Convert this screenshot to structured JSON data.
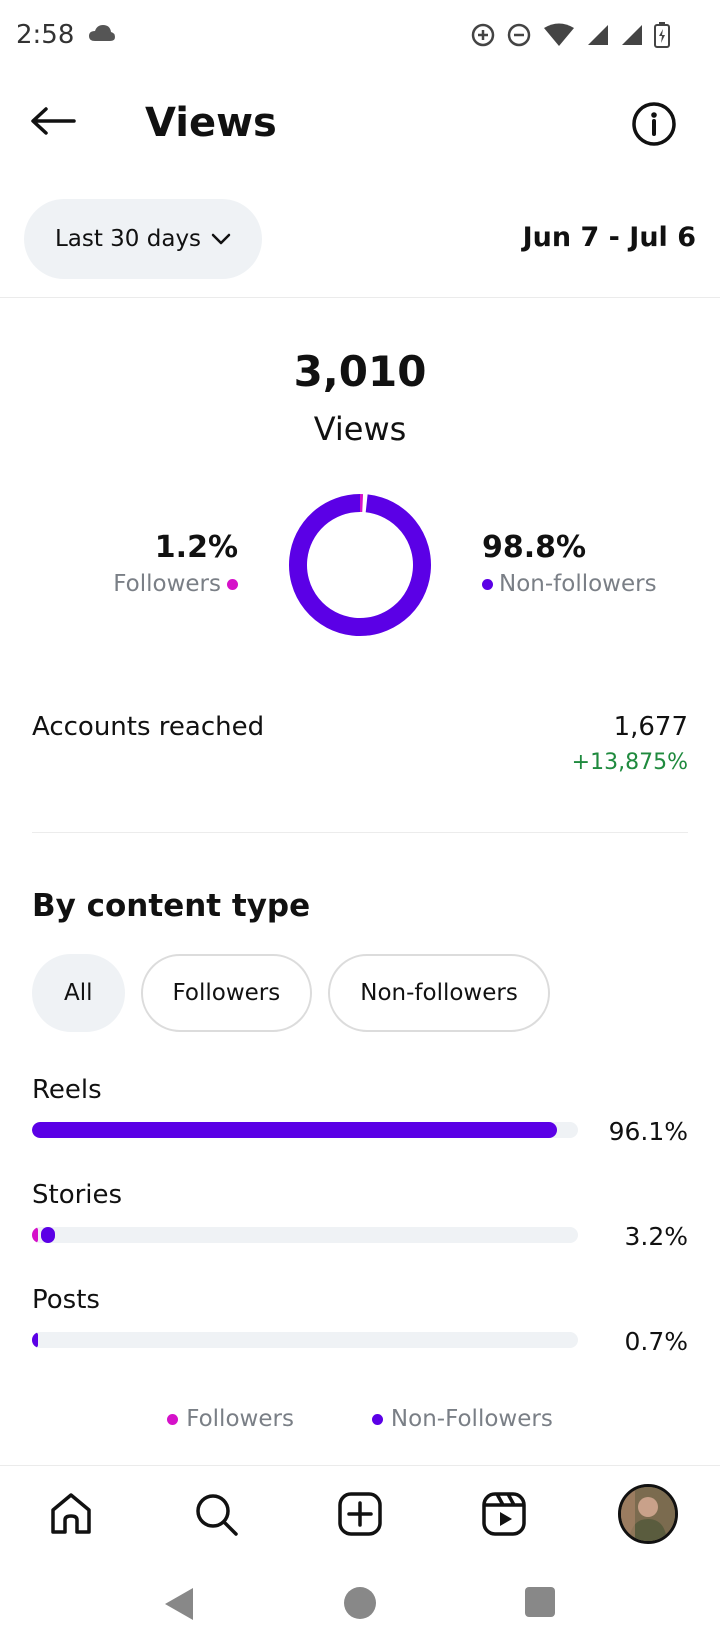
{
  "status_bar": {
    "time": "2:58"
  },
  "header": {
    "title": "Views"
  },
  "range": {
    "label": "Last 30 days",
    "dates": "Jun 7 - Jul 6"
  },
  "summary": {
    "total": "3,010",
    "total_label": "Views"
  },
  "audience_split": {
    "followers": {
      "pct": "1.2%",
      "label": "Followers",
      "value": 1.2,
      "color": "#d511c9"
    },
    "non_followers": {
      "pct": "98.8%",
      "label": "Non-followers",
      "value": 98.8,
      "color": "#5b00e6"
    }
  },
  "reach": {
    "label": "Accounts reached",
    "value": "1,677",
    "change": "+13,875%"
  },
  "content_type": {
    "title": "By content type",
    "filters": [
      "All",
      "Followers",
      "Non-followers"
    ],
    "rows": [
      {
        "label": "Reels",
        "pct": "96.1%",
        "value": 96.1,
        "followers": 0,
        "non_followers": 96.1
      },
      {
        "label": "Stories",
        "pct": "3.2%",
        "value": 3.2,
        "followers": 0.6,
        "non_followers": 2.6
      },
      {
        "label": "Posts",
        "pct": "0.7%",
        "value": 0.7,
        "followers": 0,
        "non_followers": 0.7
      }
    ],
    "legend": [
      "Followers",
      "Non-Followers"
    ]
  },
  "colors": {
    "followers": "#d511c9",
    "non_followers": "#5b00e6",
    "positive": "#1f8a3e"
  }
}
